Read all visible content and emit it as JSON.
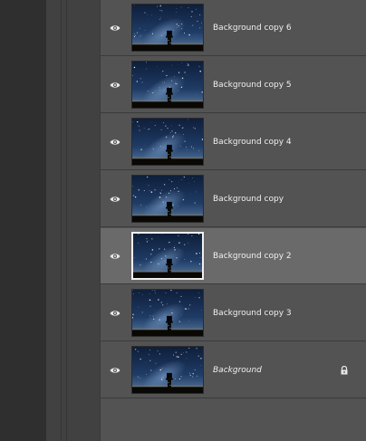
{
  "layers": [
    {
      "name": "Background copy 6",
      "selected": false,
      "italic": false,
      "locked": false
    },
    {
      "name": "Background copy 5",
      "selected": false,
      "italic": false,
      "locked": false
    },
    {
      "name": "Background copy 4",
      "selected": false,
      "italic": false,
      "locked": false
    },
    {
      "name": "Background copy",
      "selected": false,
      "italic": false,
      "locked": false
    },
    {
      "name": "Background copy 2",
      "selected": true,
      "italic": false,
      "locked": false
    },
    {
      "name": "Background copy 3",
      "selected": false,
      "italic": false,
      "locked": false
    },
    {
      "name": "Background",
      "selected": false,
      "italic": true,
      "locked": true
    }
  ],
  "icons": {
    "visibility": "eye-icon",
    "lock": "lock-icon"
  },
  "colors": {
    "panel_bg": "#535353",
    "selected_row_bg": "#6a6a6a",
    "text": "#f0f0f0"
  }
}
